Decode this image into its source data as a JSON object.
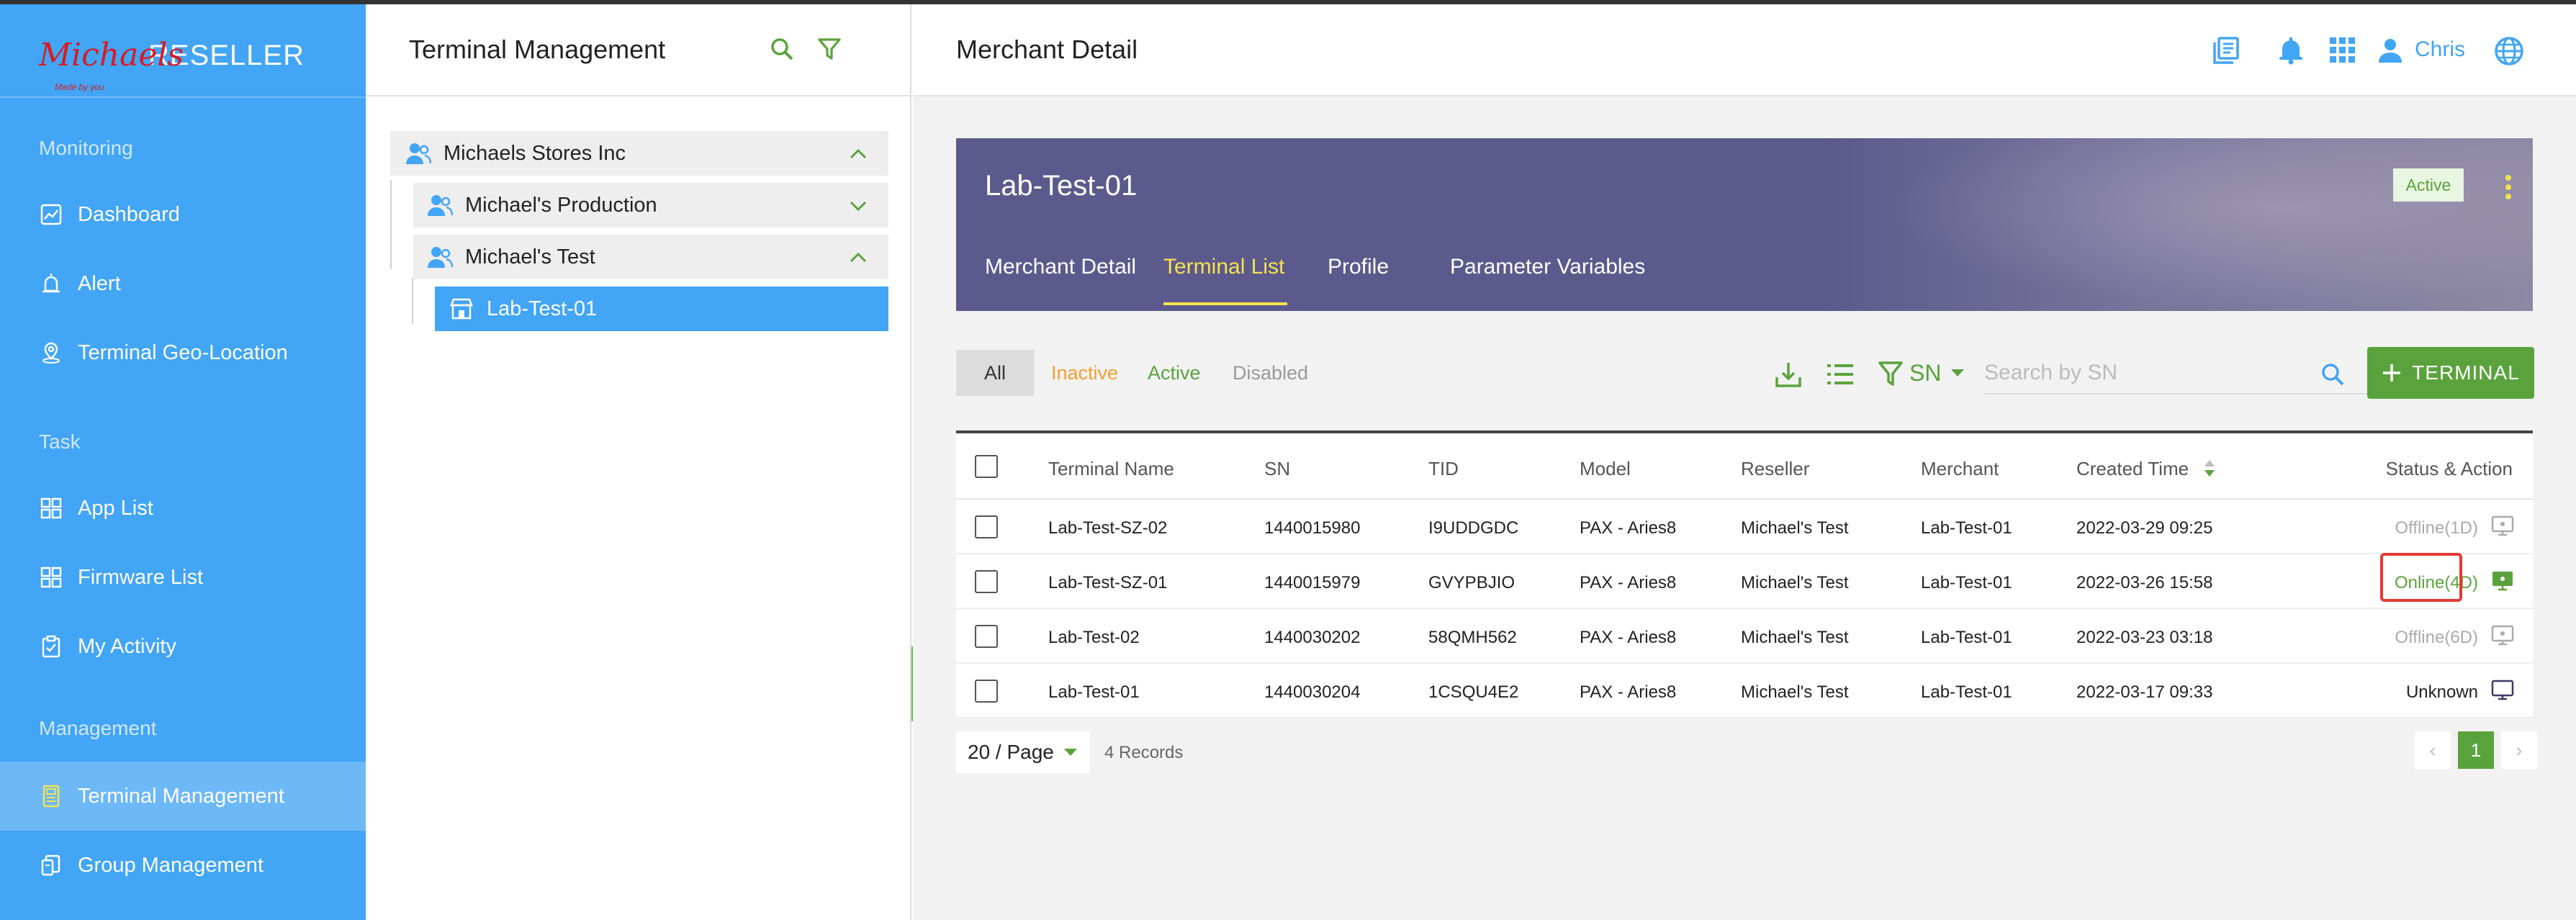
{
  "app": {
    "logo_text": "Michaels",
    "logo_tagline": "Made by you",
    "brand": "RESELLER"
  },
  "sidebar": {
    "sections": [
      {
        "title": "Monitoring",
        "items": [
          {
            "label": "Dashboard",
            "icon": "chart-icon"
          },
          {
            "label": "Alert",
            "icon": "alert-icon"
          },
          {
            "label": "Terminal Geo-Location",
            "icon": "location-icon"
          }
        ]
      },
      {
        "title": "Task",
        "items": [
          {
            "label": "App List",
            "icon": "grid-icon"
          },
          {
            "label": "Firmware List",
            "icon": "grid-icon"
          },
          {
            "label": "My Activity",
            "icon": "clipboard-icon"
          }
        ]
      },
      {
        "title": "Management",
        "items": [
          {
            "label": "Terminal Management",
            "icon": "terminal-icon",
            "active": true
          },
          {
            "label": "Group Management",
            "icon": "group-icon"
          }
        ]
      }
    ]
  },
  "tree": {
    "title": "Terminal Management",
    "nodes": [
      {
        "label": "Michaels Stores Inc",
        "expanded": true
      },
      {
        "label": "Michael's Production",
        "expanded": false
      },
      {
        "label": "Michael's Test",
        "expanded": true
      },
      {
        "label": "Lab-Test-01",
        "selected": true
      }
    ]
  },
  "header": {
    "title": "Merchant Detail",
    "user": "Chris"
  },
  "merchant": {
    "name": "Lab-Test-01",
    "status": "Active",
    "tabs": [
      "Merchant Detail",
      "Terminal List",
      "Profile",
      "Parameter Variables"
    ],
    "active_tab": "Terminal List"
  },
  "filters": {
    "all": "All",
    "inactive": "Inactive",
    "active": "Active",
    "disabled": "Disabled",
    "search_field": "SN",
    "search_placeholder": "Search by SN",
    "add_button": "TERMINAL"
  },
  "colors": {
    "sidebar": "#42a5f5",
    "accent_green": "#5aa33c",
    "inactive_orange": "#f0a030",
    "banner": "#5c5a8c",
    "highlight_red": "#e53935"
  },
  "table": {
    "columns": [
      "Terminal Name",
      "SN",
      "TID",
      "Model",
      "Reseller",
      "Merchant",
      "Created Time",
      "Status & Action"
    ],
    "rows": [
      {
        "name": "Lab-Test-SZ-02",
        "sn": "1440015980",
        "tid": "I9UDDGDC",
        "model": "PAX - Aries8",
        "reseller": "Michael's Test",
        "merchant": "Lab-Test-01",
        "created": "2022-03-29 09:25",
        "status": "Offline(1D)"
      },
      {
        "name": "Lab-Test-SZ-01",
        "sn": "1440015979",
        "tid": "GVYPBJIO",
        "model": "PAX - Aries8",
        "reseller": "Michael's Test",
        "merchant": "Lab-Test-01",
        "created": "2022-03-26 15:58",
        "status": "Online(4D)"
      },
      {
        "name": "Lab-Test-02",
        "sn": "1440030202",
        "tid": "58QMH562",
        "model": "PAX - Aries8",
        "reseller": "Michael's Test",
        "merchant": "Lab-Test-01",
        "created": "2022-03-23 03:18",
        "status": "Offline(6D)"
      },
      {
        "name": "Lab-Test-01",
        "sn": "1440030204",
        "tid": "1CSQU4E2",
        "model": "PAX - Aries8",
        "reseller": "Michael's Test",
        "merchant": "Lab-Test-01",
        "created": "2022-03-17 09:33",
        "status": "Unknown"
      }
    ]
  },
  "pagination": {
    "page_size": "20 / Page",
    "records": "4 Records",
    "current_page": "1",
    "prev": "‹",
    "next": "›"
  }
}
